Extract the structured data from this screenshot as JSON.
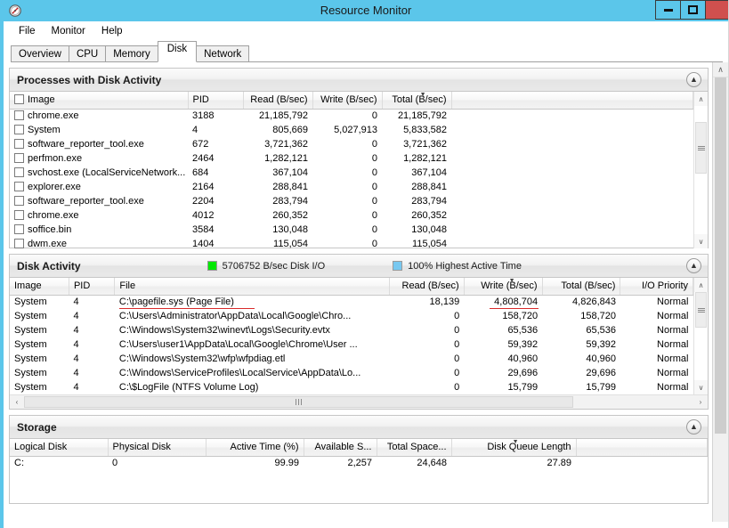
{
  "window": {
    "title": "Resource Monitor",
    "app_icon": "resource-monitor-icon",
    "minimize_label": "Minimize",
    "maximize_label": "Maximize",
    "close_label": "Close"
  },
  "menubar": {
    "items": [
      {
        "label": "File"
      },
      {
        "label": "Monitor"
      },
      {
        "label": "Help"
      }
    ]
  },
  "tabs": [
    {
      "label": "Overview",
      "active": false
    },
    {
      "label": "CPU",
      "active": false
    },
    {
      "label": "Memory",
      "active": false
    },
    {
      "label": "Disk",
      "active": true
    },
    {
      "label": "Network",
      "active": false
    }
  ],
  "processes_panel": {
    "title": "Processes with Disk Activity",
    "collapse_icon": "chevron-up-icon",
    "columns": [
      {
        "label": "Image",
        "align": "left",
        "sorted": false
      },
      {
        "label": "PID",
        "align": "left",
        "sorted": false
      },
      {
        "label": "Read (B/sec)",
        "align": "right",
        "sorted": false
      },
      {
        "label": "Write (B/sec)",
        "align": "right",
        "sorted": false
      },
      {
        "label": "Total (B/sec)",
        "align": "right",
        "sorted": true
      },
      {
        "label": "",
        "align": "left",
        "sorted": false
      }
    ],
    "sort_indicator": "descending-triangle",
    "rows": [
      {
        "image": "chrome.exe",
        "pid": "3188",
        "read": "21,185,792",
        "write": "0",
        "total": "21,185,792"
      },
      {
        "image": "System",
        "pid": "4",
        "read": "805,669",
        "write": "5,027,913",
        "total": "5,833,582"
      },
      {
        "image": "software_reporter_tool.exe",
        "pid": "672",
        "read": "3,721,362",
        "write": "0",
        "total": "3,721,362"
      },
      {
        "image": "perfmon.exe",
        "pid": "2464",
        "read": "1,282,121",
        "write": "0",
        "total": "1,282,121"
      },
      {
        "image": "svchost.exe (LocalServiceNetwork...",
        "pid": "684",
        "read": "367,104",
        "write": "0",
        "total": "367,104"
      },
      {
        "image": "explorer.exe",
        "pid": "2164",
        "read": "288,841",
        "write": "0",
        "total": "288,841"
      },
      {
        "image": "software_reporter_tool.exe",
        "pid": "2204",
        "read": "283,794",
        "write": "0",
        "total": "283,794"
      },
      {
        "image": "chrome.exe",
        "pid": "4012",
        "read": "260,352",
        "write": "0",
        "total": "260,352"
      },
      {
        "image": "soffice.bin",
        "pid": "3584",
        "read": "130,048",
        "write": "0",
        "total": "130,048"
      },
      {
        "image": "dwm.exe",
        "pid": "1404",
        "read": "115,054",
        "write": "0",
        "total": "115,054"
      }
    ]
  },
  "disk_activity_panel": {
    "title": "Disk Activity",
    "collapse_icon": "chevron-up-icon",
    "legend": [
      {
        "label": "5706752 B/sec Disk I/O",
        "color": "#00e800",
        "swatch_name": "disk-io-swatch"
      },
      {
        "label": "100% Highest Active Time",
        "color": "#78c8f0",
        "swatch_name": "active-time-swatch"
      }
    ],
    "columns": [
      {
        "label": "Image",
        "align": "left",
        "sorted": false
      },
      {
        "label": "PID",
        "align": "left",
        "sorted": false
      },
      {
        "label": "File",
        "align": "left",
        "sorted": false
      },
      {
        "label": "Read (B/sec)",
        "align": "right",
        "sorted": false
      },
      {
        "label": "Write (B/sec)",
        "align": "right",
        "sorted": true
      },
      {
        "label": "Total (B/sec)",
        "align": "right",
        "sorted": false
      },
      {
        "label": "I/O Priority",
        "align": "right",
        "sorted": false
      }
    ],
    "sort_indicator": "descending-triangle",
    "rows": [
      {
        "image": "System",
        "pid": "4",
        "file": "C:\\pagefile.sys (Page File)",
        "read": "18,139",
        "write": "4,808,704",
        "total": "4,826,843",
        "priority": "Normal",
        "highlight_file": true,
        "highlight_write": true
      },
      {
        "image": "System",
        "pid": "4",
        "file": "C:\\Users\\Administrator\\AppData\\Local\\Google\\Chro...",
        "read": "0",
        "write": "158,720",
        "total": "158,720",
        "priority": "Normal"
      },
      {
        "image": "System",
        "pid": "4",
        "file": "C:\\Windows\\System32\\winevt\\Logs\\Security.evtx",
        "read": "0",
        "write": "65,536",
        "total": "65,536",
        "priority": "Normal"
      },
      {
        "image": "System",
        "pid": "4",
        "file": "C:\\Users\\user1\\AppData\\Local\\Google\\Chrome\\User ...",
        "read": "0",
        "write": "59,392",
        "total": "59,392",
        "priority": "Normal"
      },
      {
        "image": "System",
        "pid": "4",
        "file": "C:\\Windows\\System32\\wfp\\wfpdiag.etl",
        "read": "0",
        "write": "40,960",
        "total": "40,960",
        "priority": "Normal"
      },
      {
        "image": "System",
        "pid": "4",
        "file": "C:\\Windows\\ServiceProfiles\\LocalService\\AppData\\Lo...",
        "read": "0",
        "write": "29,696",
        "total": "29,696",
        "priority": "Normal"
      },
      {
        "image": "System",
        "pid": "4",
        "file": "C:\\$LogFile (NTFS Volume Log)",
        "read": "0",
        "write": "15,799",
        "total": "15,799",
        "priority": "Normal"
      }
    ]
  },
  "storage_panel": {
    "title": "Storage",
    "collapse_icon": "chevron-up-icon",
    "columns": [
      {
        "label": "Logical Disk",
        "align": "left",
        "sorted": false
      },
      {
        "label": "Physical Disk",
        "align": "left",
        "sorted": false
      },
      {
        "label": "Active Time (%)",
        "align": "right",
        "sorted": false
      },
      {
        "label": "Available S...",
        "align": "right",
        "sorted": false
      },
      {
        "label": "Total Space...",
        "align": "right",
        "sorted": false
      },
      {
        "label": "Disk Queue Length",
        "align": "right",
        "sorted": true
      },
      {
        "label": "",
        "align": "left",
        "sorted": false
      }
    ],
    "sort_indicator": "descending-triangle",
    "rows": [
      {
        "logical": "C:",
        "physical": "0",
        "active_time": "99.99",
        "available": "2,257",
        "total_space": "24,648",
        "queue_length": "27.89",
        "highlight_queue": true
      }
    ]
  },
  "annotations": {
    "color": "#d92b2b",
    "underlined_items": [
      "C:\\pagefile.sys (Page File)",
      "4,808,704",
      "27.89"
    ]
  },
  "scrollbars": {
    "up_arrow": "∧",
    "down_arrow": "∨",
    "left_arrow": "‹",
    "right_arrow": "›"
  }
}
